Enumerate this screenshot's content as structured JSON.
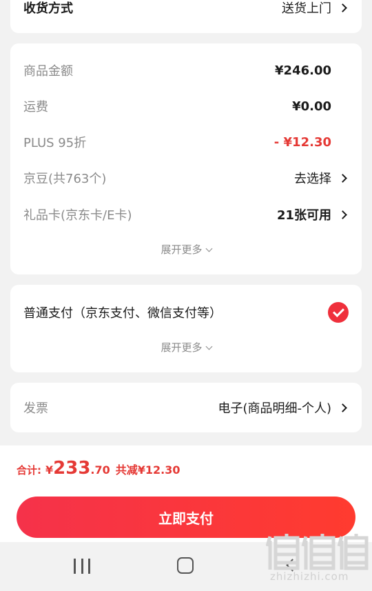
{
  "delivery": {
    "label": "收货方式",
    "value": "送货上门"
  },
  "price_summary": {
    "goods_amount_label": "商品金额",
    "goods_amount_value": "¥246.00",
    "shipping_label": "运费",
    "shipping_value": "¥0.00",
    "plus_label": "PLUS 95折",
    "plus_value": "- ¥12.30",
    "jingdou_label": "京豆(共763个)",
    "jingdou_value": "去选择",
    "giftcard_label": "礼品卡(京东卡/E卡)",
    "giftcard_value": "21张可用",
    "expand_label": "展开更多"
  },
  "payment": {
    "method_label": "普通支付（京东支付、微信支付等）",
    "expand_label": "展开更多"
  },
  "invoice": {
    "label": "发票",
    "value": "电子(商品明细-个人)"
  },
  "checkout": {
    "total_label": "合计:",
    "currency": "¥",
    "total_integer": "233",
    "total_decimal": ".70",
    "discount": "共减¥12.30",
    "pay_button": "立即支付"
  },
  "watermark": {
    "logo_text": "值值值",
    "site": "zhizhizhi.com"
  },
  "colors": {
    "accent_red": "#e53935",
    "button_red": "#f5324a",
    "background": "#f2f2f2"
  }
}
